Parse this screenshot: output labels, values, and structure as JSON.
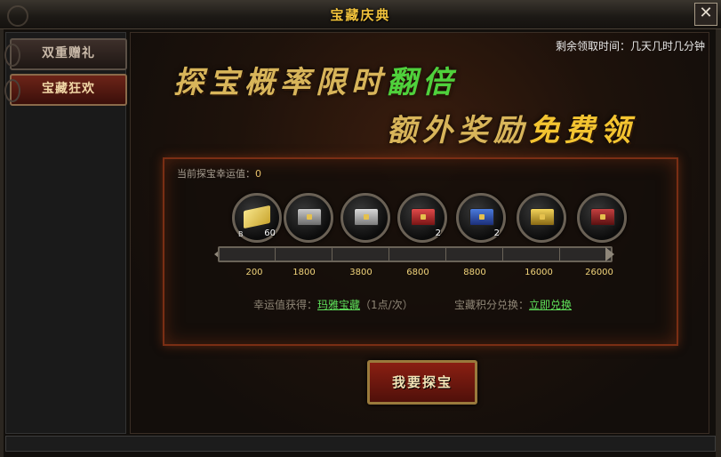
{
  "window": {
    "title": "宝藏庆典",
    "close_glyph": "✕"
  },
  "sidebar": {
    "tabs": [
      {
        "label": "双重赠礼",
        "active": false
      },
      {
        "label": "宝藏狂欢",
        "active": true
      }
    ]
  },
  "main": {
    "timer": "剩余领取时间：几天几时几分钟",
    "banner_line1_prefix": "探宝概率限时",
    "banner_line1_highlight": "翻倍",
    "banner_line2_prefix": "额外奖励",
    "banner_line2_highlight": "免费领",
    "lucky_label": "当前探宝幸运值：",
    "lucky_value": "0",
    "rewards": [
      {
        "name": "scroll",
        "count": "60",
        "bound": "B"
      },
      {
        "name": "silver-chest",
        "count": ""
      },
      {
        "name": "silver-chest-2",
        "count": ""
      },
      {
        "name": "red-chest",
        "count": "2"
      },
      {
        "name": "blue-chest",
        "count": "2"
      },
      {
        "name": "gold-chest",
        "count": ""
      },
      {
        "name": "crimson-chest",
        "count": ""
      }
    ],
    "thresholds": [
      "200",
      "1800",
      "3800",
      "6800",
      "8800",
      "16000",
      "26000"
    ],
    "luck_gain_label": "幸运值获得：",
    "luck_gain_link": "玛雅宝藏",
    "luck_gain_rate": "（1点/次）",
    "exchange_label": "宝藏积分兑换：",
    "exchange_link": "立即兑换",
    "action_button": "我要探宝"
  },
  "colors": {
    "accent_gold": "#f0c23c",
    "highlight_green": "#4fd13c",
    "link_green": "#5fe05a",
    "button_red": "#8a1f12"
  }
}
